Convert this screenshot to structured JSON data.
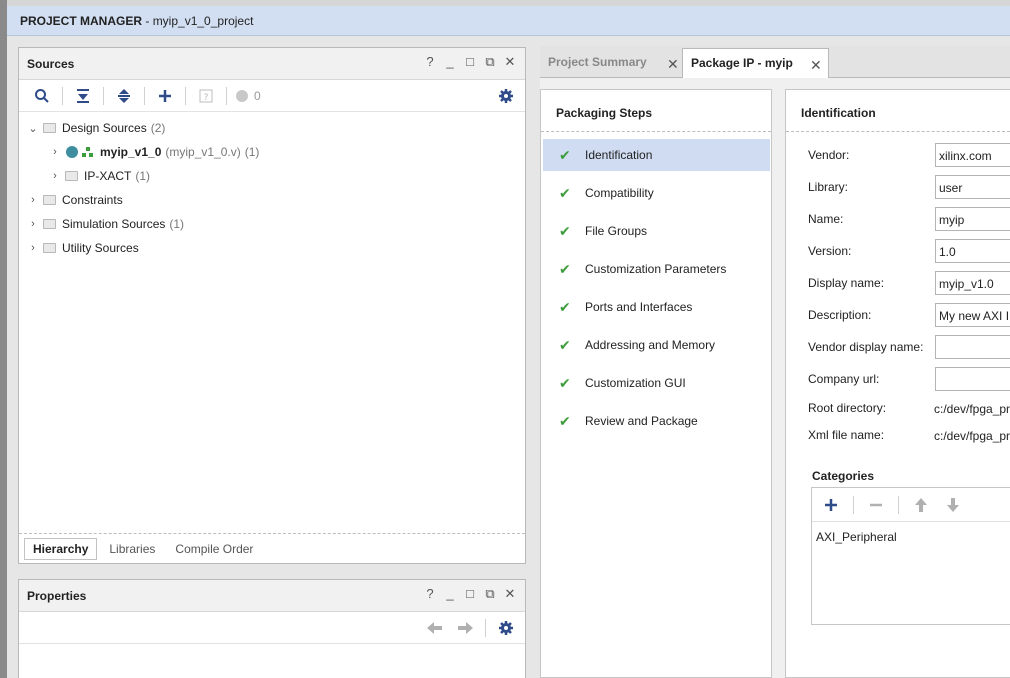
{
  "project_manager": {
    "label": "PROJECT MANAGER",
    "separator": " - ",
    "project_name": "myip_v1_0_project"
  },
  "sources": {
    "title": "Sources",
    "window_controls": [
      "?",
      "_",
      "□",
      "⧉",
      "✕"
    ],
    "toolbar": {
      "search": "search-icon",
      "collapse": "collapse-all-icon",
      "expand": "expand-all-icon",
      "add": "add-icon",
      "unknown": "help-box-icon",
      "status_count": "0"
    },
    "tree": [
      {
        "label": "Design Sources",
        "count": "(2)",
        "level": 0,
        "expanded": true
      },
      {
        "label": "myip_v1_0",
        "detail": "(myip_v1_0.v)",
        "count": "(1)",
        "level": 1,
        "expanded": false,
        "bold": true
      },
      {
        "label": "IP-XACT",
        "count": "(1)",
        "level": 1,
        "expanded": false
      },
      {
        "label": "Constraints",
        "count": "",
        "level": 0,
        "expanded": false
      },
      {
        "label": "Simulation Sources",
        "count": "(1)",
        "level": 0,
        "expanded": false
      },
      {
        "label": "Utility Sources",
        "count": "",
        "level": 0,
        "expanded": false
      }
    ],
    "bottom_tabs": [
      "Hierarchy",
      "Libraries",
      "Compile Order"
    ],
    "active_bottom_tab": "Hierarchy"
  },
  "properties": {
    "title": "Properties",
    "window_controls": [
      "?",
      "_",
      "□",
      "⧉",
      "✕"
    ]
  },
  "tabs": [
    {
      "label": "Project Summary",
      "active": false
    },
    {
      "label": "Package IP - myip",
      "active": true
    }
  ],
  "packaging_steps": {
    "title": "Packaging Steps",
    "steps": [
      "Identification",
      "Compatibility",
      "File Groups",
      "Customization Parameters",
      "Ports and Interfaces",
      "Addressing and Memory",
      "Customization GUI",
      "Review and Package"
    ],
    "selected": "Identification"
  },
  "identification": {
    "title": "Identification",
    "fields": {
      "vendor": {
        "label": "Vendor:",
        "value": "xilinx.com"
      },
      "library": {
        "label": "Library:",
        "value": "user"
      },
      "name": {
        "label": "Name:",
        "value": "myip"
      },
      "version": {
        "label": "Version:",
        "value": "1.0"
      },
      "display_name": {
        "label": "Display name:",
        "value": "myip_v1.0"
      },
      "description": {
        "label": "Description:",
        "value": "My new AXI IP"
      },
      "vendor_display_name": {
        "label": "Vendor display name:",
        "value": ""
      },
      "company_url": {
        "label": "Company url:",
        "value": ""
      },
      "root_directory": {
        "label": "Root directory:",
        "value": "c:/dev/fpga_pr"
      },
      "xml_file_name": {
        "label": "Xml file name:",
        "value": "c:/dev/fpga_pr"
      }
    },
    "categories": {
      "title": "Categories",
      "items": [
        "AXI_Peripheral"
      ]
    }
  },
  "colors": {
    "accent_blue": "#2f4b8a",
    "check_green": "#3d9d3d",
    "selection": "#cfdcf2"
  }
}
